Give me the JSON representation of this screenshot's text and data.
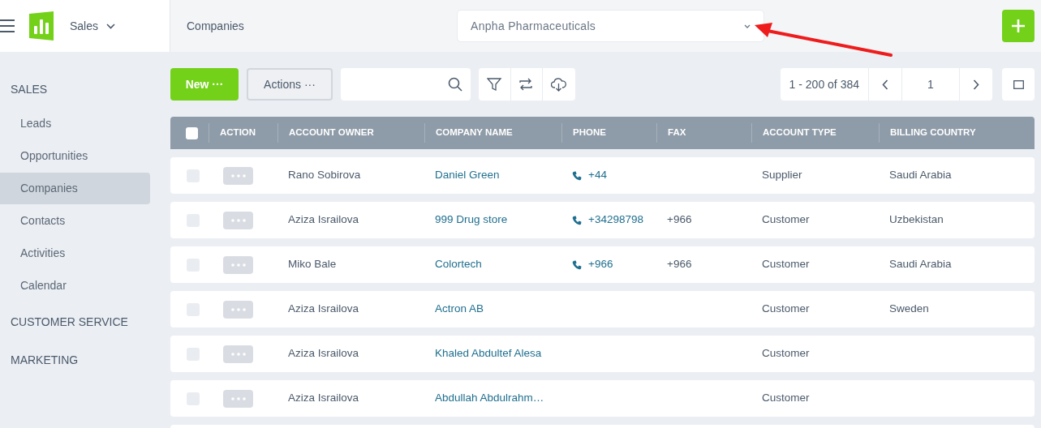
{
  "app": {
    "module": "Sales"
  },
  "breadcrumb": "Companies",
  "company_select": {
    "value": "Anpha Pharmaceuticals"
  },
  "sidebar": {
    "sections": [
      {
        "label": "SALES",
        "items": [
          {
            "label": "Leads",
            "selected": false
          },
          {
            "label": "Opportunities",
            "selected": false
          },
          {
            "label": "Companies",
            "selected": true
          },
          {
            "label": "Contacts",
            "selected": false
          },
          {
            "label": "Activities",
            "selected": false
          },
          {
            "label": "Calendar",
            "selected": false
          }
        ]
      },
      {
        "label": "CUSTOMER SERVICE"
      },
      {
        "label": "MARKETING"
      }
    ]
  },
  "toolbar": {
    "new_button": "New ···",
    "actions_button": "Actions ···",
    "pagination": {
      "range": "1 - 200 of 384",
      "page": "1"
    }
  },
  "table": {
    "header_checked": false,
    "columns": [
      "ACTION",
      "ACCOUNT OWNER",
      "COMPANY NAME",
      "PHONE",
      "FAX",
      "ACCOUNT TYPE",
      "BILLING COUNTRY"
    ],
    "rows": [
      {
        "checked": false,
        "owner": "Rano Sobirova",
        "company": "Daniel Green",
        "phone": "+44",
        "type": "Supplier",
        "country": "Saudi Arabia"
      },
      {
        "checked": false,
        "owner": "Aziza Israilova",
        "company": "999 Drug store",
        "phone": "+34298798",
        "fax": "+966",
        "type": "Customer",
        "country": "Uzbekistan"
      },
      {
        "checked": false,
        "owner": "Miko Bale",
        "company": "Colortech",
        "phone": "+966",
        "fax": "+966",
        "type": "Customer",
        "country": "Saudi Arabia"
      },
      {
        "checked": false,
        "owner": "Aziza Israilova",
        "company": "Actron AB",
        "type": "Customer",
        "country": "Sweden"
      },
      {
        "checked": false,
        "owner": "Aziza Israilova",
        "company": "Khaled Abdultef Alesa",
        "type": "Customer"
      },
      {
        "checked": false,
        "owner": "Aziza Israilova",
        "company": "Abdullah Abdulrahm…",
        "type": "Customer"
      }
    ]
  }
}
